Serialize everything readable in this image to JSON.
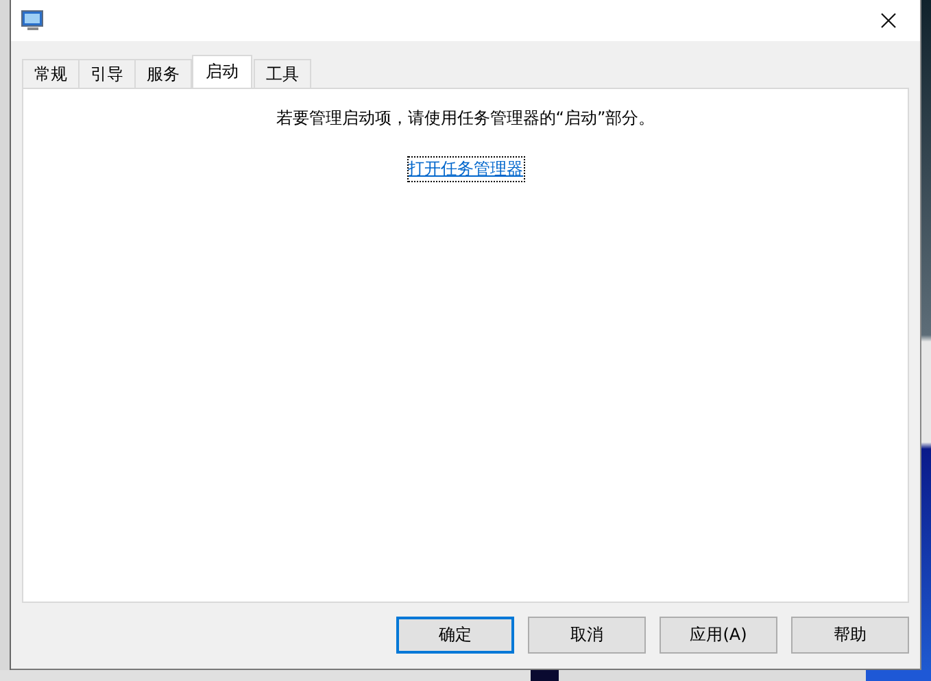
{
  "tabs": [
    {
      "label": "常规",
      "selected": false
    },
    {
      "label": "引导",
      "selected": false
    },
    {
      "label": "服务",
      "selected": false
    },
    {
      "label": "启动",
      "selected": true
    },
    {
      "label": "工具",
      "selected": false
    }
  ],
  "message": "若要管理启动项，请使用任务管理器的“启动”部分。",
  "link": "打开任务管理器",
  "buttons": [
    {
      "label": "确定",
      "default": true
    },
    {
      "label": "取消",
      "default": false
    },
    {
      "label": "应用(A)",
      "default": false
    },
    {
      "label": "帮助",
      "default": false
    }
  ]
}
